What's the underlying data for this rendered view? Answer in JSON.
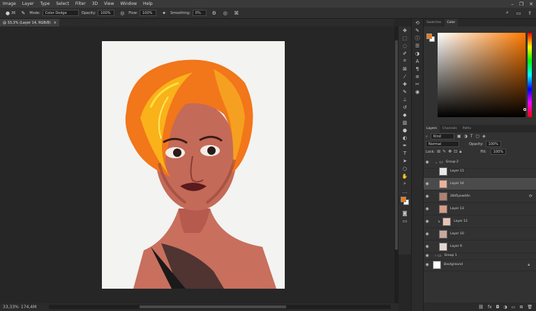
{
  "menu": [
    "Image",
    "Layer",
    "Type",
    "Select",
    "Filter",
    "3D",
    "View",
    "Window",
    "Help"
  ],
  "options": {
    "size_value": "36",
    "mode_label": "Mode:",
    "mode_value": "Color Dodge",
    "opacity_label": "Opacity:",
    "opacity_value": "100%",
    "flow_label": "Flow:",
    "flow_value": "100%",
    "smoothing_label": "Smoothing:",
    "smoothing_value": "0%"
  },
  "document_tab": {
    "title": "@ 33,3% (Layer 14, RGB/8)",
    "close": "×"
  },
  "status": {
    "zoom": "33,33%",
    "doc_info": "174,4M"
  },
  "color_panel": {
    "tabs": [
      "Swatches",
      "Color"
    ],
    "active": "Color",
    "fg_color": "#f07a14",
    "bg_color": "#ffffff"
  },
  "layers_panel": {
    "tabs": [
      "Layers",
      "Channels",
      "Paths"
    ],
    "active": "Layers",
    "filter_kind": "Kind",
    "blend_mode": "Normal",
    "opacity_label": "Opacity:",
    "opacity_value": "100%",
    "lock_label": "Lock:",
    "fill_label": "Fill:",
    "fill_value": "100%",
    "layers": [
      {
        "name": "Group 2",
        "type": "group",
        "visible": true
      },
      {
        "name": "Layer 11",
        "type": "layer",
        "visible": false
      },
      {
        "name": "Layer 14",
        "type": "layer",
        "visible": true,
        "selected": true
      },
      {
        "name": "28d5ysw44n",
        "type": "layer",
        "visible": true
      },
      {
        "name": "Layer 13",
        "type": "layer",
        "visible": true
      },
      {
        "name": "Layer 12",
        "type": "layer",
        "visible": true
      },
      {
        "name": "Layer 10",
        "type": "layer",
        "visible": true
      },
      {
        "name": "Layer 9",
        "type": "layer",
        "visible": true
      },
      {
        "name": "Group 1",
        "type": "group",
        "visible": true
      },
      {
        "name": "Background",
        "type": "background",
        "visible": true
      }
    ]
  }
}
